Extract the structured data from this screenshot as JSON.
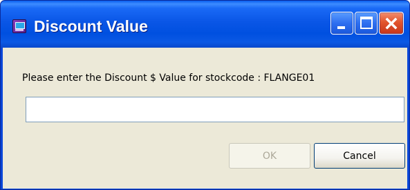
{
  "window": {
    "title": "Discount Value",
    "app_icon": "dialog-app-icon",
    "controls": {
      "minimize": "minimize-icon",
      "maximize": "maximize-icon",
      "close": "close-icon"
    }
  },
  "dialog": {
    "prompt": "Please enter the Discount $ Value for stockcode : FLANGE01",
    "input_value": "",
    "ok_label": "OK",
    "ok_enabled": false,
    "cancel_label": "Cancel"
  },
  "colors": {
    "titlebar": "#0a56e6",
    "client_bg": "#ece9d8",
    "close_button": "#e2552e",
    "disabled_text": "#aca899"
  }
}
